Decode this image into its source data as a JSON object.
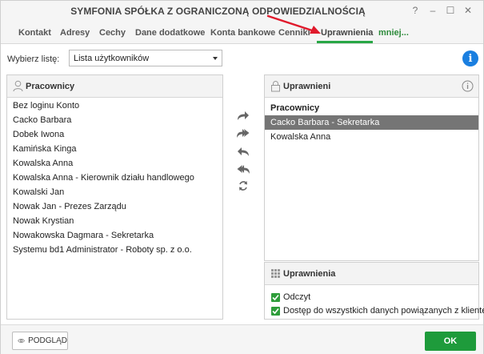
{
  "window": {
    "title": "SYMFONIA SPÓŁKA Z OGRANICZONĄ ODPOWIEDZIALNOŚCIĄ",
    "controls": [
      "?",
      "–",
      "☐",
      "✕"
    ]
  },
  "tabs": [
    {
      "label": "Kontakt"
    },
    {
      "label": "Adresy"
    },
    {
      "label": "Cechy"
    },
    {
      "label": "Dane dodatkowe"
    },
    {
      "label": "Konta bankowe"
    },
    {
      "label": "Cenniki"
    },
    {
      "label": "Uprawnienia",
      "active": true
    },
    {
      "label": "mniej..."
    }
  ],
  "list_selector": {
    "label": "Wybierz listę:",
    "value": "Lista użytkowników"
  },
  "employees_panel": {
    "title": "Pracownicy",
    "items": [
      "Bez loginu Konto",
      "Cacko Barbara",
      "Dobek Iwona",
      "Kamińska Kinga",
      "Kowalska Anna",
      "Kowalska Anna - Kierownik działu handlowego",
      "Kowalski Jan",
      "Nowak Jan - Prezes Zarządu",
      "Nowak Krystian",
      "Nowakowska Dagmara - Sekretarka",
      "Systemu bd1 Administrator - Roboty sp. z o.o."
    ]
  },
  "authorized_panel": {
    "title": "Uprawnieni",
    "group": "Pracownicy",
    "items": [
      {
        "label": "Cacko Barbara - Sekretarka",
        "selected": true
      },
      {
        "label": "Kowalska Anna",
        "selected": false
      }
    ]
  },
  "permissions_panel": {
    "title": "Uprawnienia",
    "items": [
      {
        "label": "Odczyt",
        "checked": true
      },
      {
        "label": "Dostęp do wszystkich danych powiązanych z klientem",
        "checked": true
      }
    ]
  },
  "footer": {
    "preview_label": "PODGLĄD",
    "ok_label": "OK"
  },
  "colors": {
    "accent_green": "#1e9b3b",
    "info_blue": "#1a7fe0",
    "selection_gray": "#757575",
    "annotation_red": "#e0192b"
  }
}
